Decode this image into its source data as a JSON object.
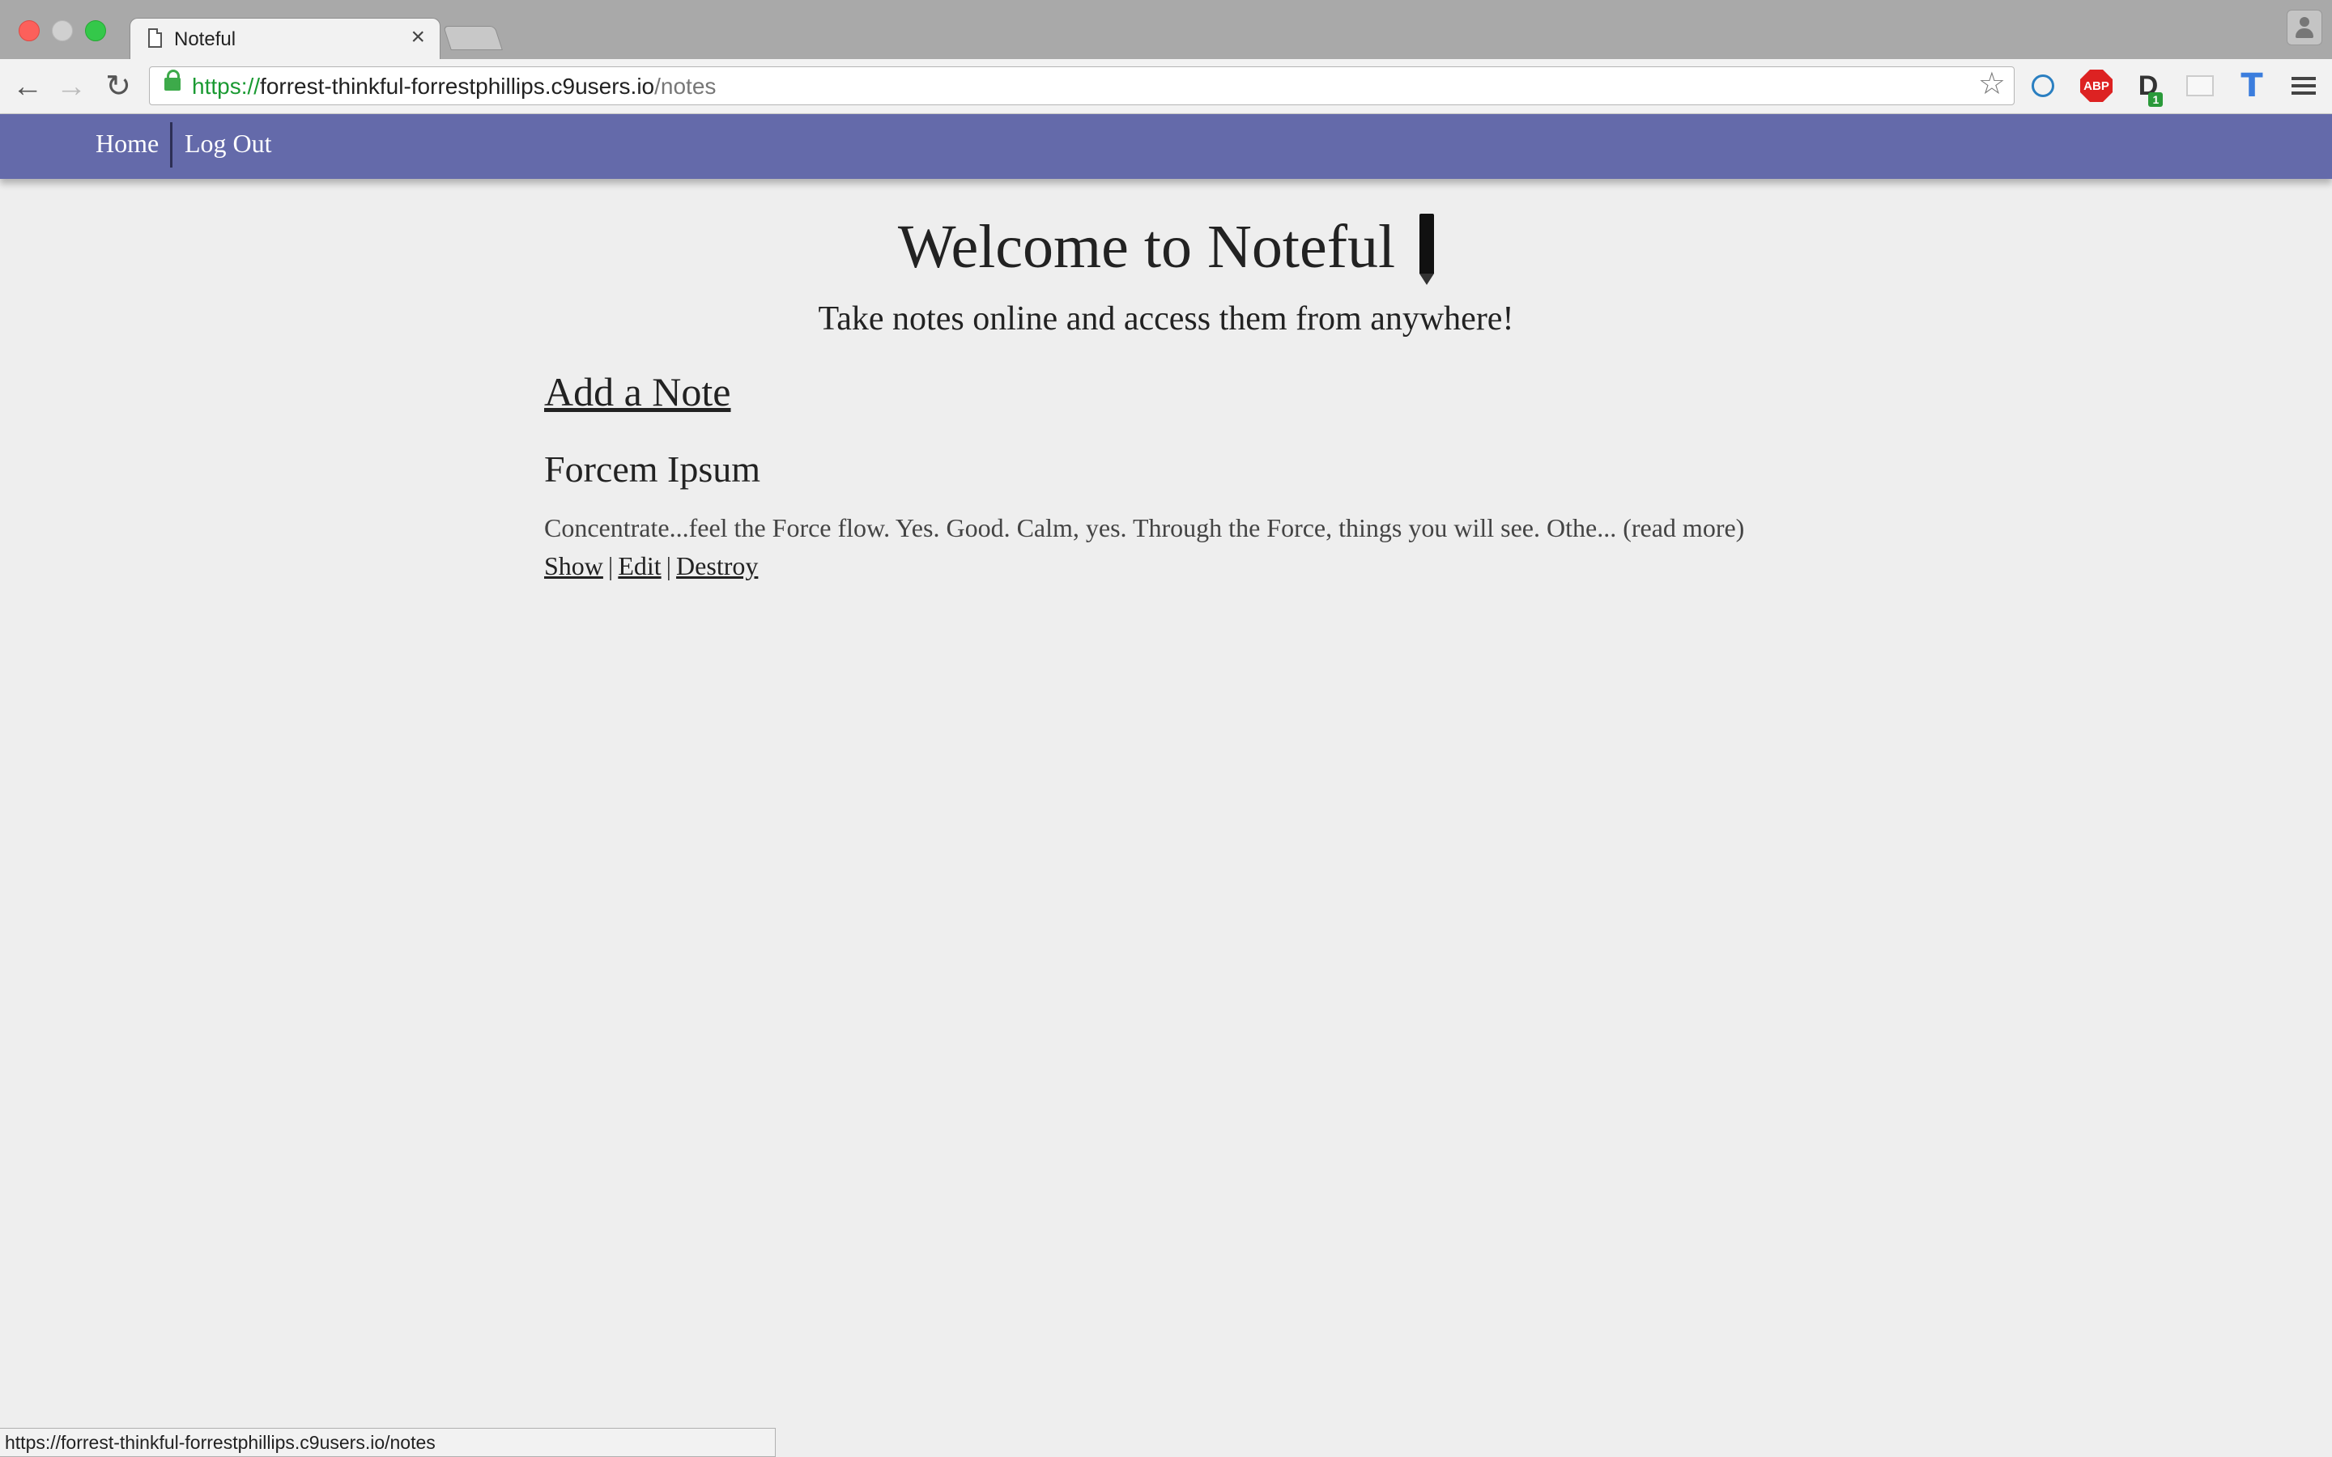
{
  "browser": {
    "tab_title": "Noteful",
    "tab_close": "×",
    "url_scheme": "https://",
    "url_host": "forrest-thinkful-forrestphillips.c9users.io",
    "url_path": "/notes",
    "back_glyph": "←",
    "forward_glyph": "→",
    "reload_glyph": "↻",
    "star_glyph": "☆",
    "extensions": {
      "abp_label": "ABP",
      "d_label": "D",
      "d_badge": "1",
      "t_label": "T"
    },
    "status_url": "https://forrest-thinkful-forrestphillips.c9users.io/notes"
  },
  "nav": {
    "home": "Home",
    "logout": "Log Out"
  },
  "hero": {
    "title": "Welcome to Noteful",
    "subtitle": "Take notes online and access them from anywhere!"
  },
  "main": {
    "add_note": "Add a Note",
    "notes": [
      {
        "title": "Forcem Ipsum",
        "excerpt": "Concentrate...feel the Force flow. Yes. Good. Calm, yes. Through the Force, things you will see. Othe...",
        "read_more": "(read more)",
        "show": "Show",
        "edit": "Edit",
        "destroy": "Destroy"
      }
    ]
  },
  "colors": {
    "nav_bg": "#646aaa",
    "page_bg": "#eeeeee",
    "scheme_green": "#1a9a32"
  }
}
